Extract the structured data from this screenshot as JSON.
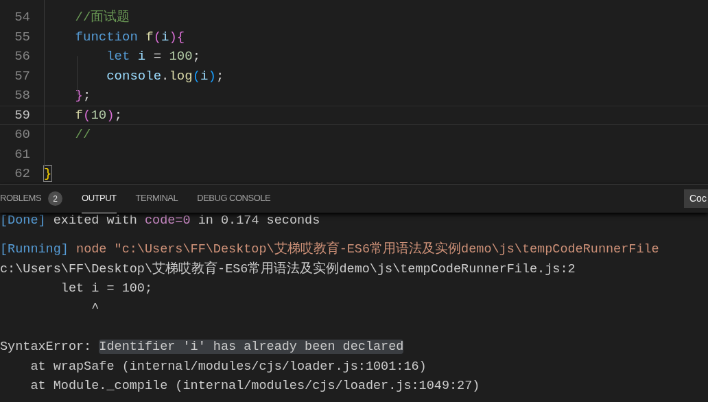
{
  "editor": {
    "lines": [
      {
        "number": "54",
        "current": false,
        "tokens": [
          {
            "kind": "comment",
            "text": "    //面试题"
          }
        ]
      },
      {
        "number": "55",
        "current": false,
        "tokens": [
          {
            "kind": "keyword",
            "text": "    function "
          },
          {
            "kind": "function",
            "text": "f"
          },
          {
            "kind": "bracket1",
            "text": "("
          },
          {
            "kind": "variable",
            "text": "i"
          },
          {
            "kind": "bracket1",
            "text": ")"
          },
          {
            "kind": "bracket1",
            "text": "{"
          }
        ]
      },
      {
        "number": "56",
        "current": false,
        "tokens": [
          {
            "kind": "keyword",
            "text": "        let "
          },
          {
            "kind": "variable",
            "text": "i"
          },
          {
            "kind": "plain",
            "text": " = "
          },
          {
            "kind": "number",
            "text": "100"
          },
          {
            "kind": "plain",
            "text": ";"
          }
        ]
      },
      {
        "number": "57",
        "current": false,
        "tokens": [
          {
            "kind": "variable",
            "text": "        console"
          },
          {
            "kind": "plain",
            "text": "."
          },
          {
            "kind": "function",
            "text": "log"
          },
          {
            "kind": "bracket2",
            "text": "("
          },
          {
            "kind": "variable",
            "text": "i"
          },
          {
            "kind": "bracket2",
            "text": ")"
          },
          {
            "kind": "plain",
            "text": ";"
          }
        ]
      },
      {
        "number": "58",
        "current": false,
        "tokens": [
          {
            "kind": "bracket1",
            "text": "    }"
          },
          {
            "kind": "plain",
            "text": ";"
          }
        ]
      },
      {
        "number": "59",
        "current": true,
        "tokens": [
          {
            "kind": "function",
            "text": "    f"
          },
          {
            "kind": "bracket1",
            "text": "("
          },
          {
            "kind": "number",
            "text": "10"
          },
          {
            "kind": "bracket1",
            "text": ")"
          },
          {
            "kind": "plain",
            "text": ";"
          }
        ]
      },
      {
        "number": "60",
        "current": false,
        "tokens": [
          {
            "kind": "comment",
            "text": "    //"
          }
        ]
      },
      {
        "number": "61",
        "current": false
      },
      {
        "number": "62",
        "current": false,
        "tokens": [
          {
            "kind": "matched",
            "text": "}"
          }
        ]
      }
    ]
  },
  "panel": {
    "tabs": [
      {
        "label": "ROBLEMS",
        "badge": "2",
        "selected": false
      },
      {
        "label": "OUTPUT",
        "selected": true
      },
      {
        "label": "TERMINAL",
        "selected": false
      },
      {
        "label": "DEBUG CONSOLE",
        "selected": false
      }
    ],
    "dropdown": "Coc",
    "output": [
      {
        "kind": "cut",
        "segments": [
          {
            "kind": "info",
            "text": "[Done]"
          },
          {
            "kind": "plain",
            "text": " exited with "
          },
          {
            "kind": "code",
            "text": "code=0"
          },
          {
            "kind": "plain",
            "text": " in 0.174 seconds"
          }
        ]
      },
      {
        "kind": "blank"
      },
      {
        "kind": "line",
        "segments": [
          {
            "kind": "info",
            "text": "[Running]"
          },
          {
            "kind": "string",
            "text": " node \"c:\\Users\\FF\\Desktop\\艾梯哎教育-ES6常用语法及实例demo\\js\\tempCodeRunnerFile"
          }
        ]
      },
      {
        "kind": "line",
        "segments": [
          {
            "kind": "plain",
            "text": "c:\\Users\\FF\\Desktop\\艾梯哎教育-ES6常用语法及实例demo\\js\\tempCodeRunnerFile.js:2"
          }
        ]
      },
      {
        "kind": "line",
        "segments": [
          {
            "kind": "plain",
            "text": "        let i = 100;"
          }
        ]
      },
      {
        "kind": "line",
        "segments": [
          {
            "kind": "plain",
            "text": "            ^"
          }
        ]
      },
      {
        "kind": "blank"
      },
      {
        "kind": "line",
        "segments": [
          {
            "kind": "plain",
            "text": "SyntaxError: "
          },
          {
            "kind": "highlight",
            "text": "Identifier 'i' has already been declared"
          }
        ]
      },
      {
        "kind": "line",
        "segments": [
          {
            "kind": "plain",
            "text": "    at wrapSafe (internal/modules/cjs/loader.js:1001:16)"
          }
        ]
      },
      {
        "kind": "line",
        "segments": [
          {
            "kind": "plain",
            "text": "    at Module._compile (internal/modules/cjs/loader.js:1049:27)"
          }
        ]
      }
    ]
  }
}
